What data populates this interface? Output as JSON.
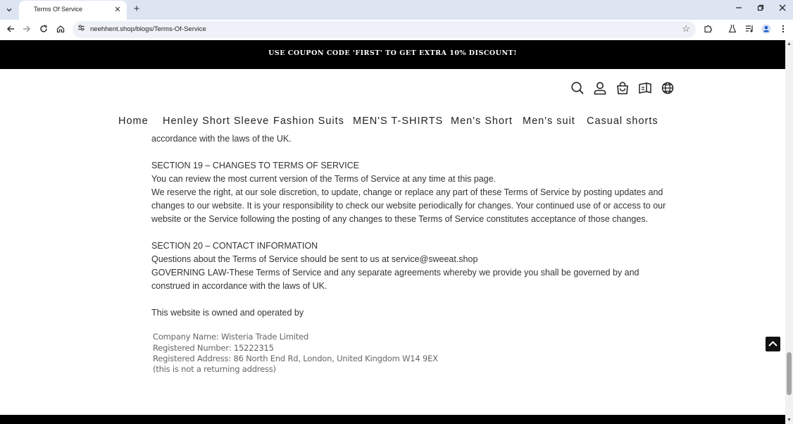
{
  "browser": {
    "tab_title": "Terms Of Service",
    "url": "neehhent.shop/blogs/Terms-Of-Service",
    "icons": [
      "tab-search-icon",
      "close-icon",
      "plus-icon",
      "minimize-icon",
      "restore-icon",
      "close-window-icon",
      "back-icon",
      "forward-icon",
      "reload-icon",
      "home-icon",
      "site-info-icon",
      "bookmark-star-icon",
      "extensions-icon",
      "labs-icon",
      "media-icon",
      "profile-icon",
      "menu-icon"
    ]
  },
  "announcement": "USE COUPON CODE 'FIRST' TO GET EXTRA 10% DISCOUNT!",
  "header_icons": [
    "search-icon",
    "account-icon",
    "cart-icon",
    "catalog-icon",
    "globe-icon"
  ],
  "nav": [
    "Home",
    "Henley Short Sleeve",
    "Fashion Suits",
    "MEN'S T-SHIRTS",
    "Men's Short",
    "Men's suit",
    "Casual shorts"
  ],
  "content": {
    "l1": "accordance with the laws of the UK.",
    "l2": "SECTION 19 – CHANGES TO TERMS OF SERVICE",
    "l3": "You can review the most current version of the Terms of Service at any time at this page.",
    "l4": "We reserve the right, at our sole discretion, to update, change or replace any part of these Terms of Service by posting updates and",
    "l5": "changes to our website. It is your responsibility to check our website periodically for changes. Your continued use of or access to our",
    "l6": "website or the Service following the posting of any changes to these Terms of Service constitutes acceptance of those changes.",
    "l7": "SECTION 20 – CONTACT INFORMATION",
    "l8": "Questions about the Terms of Service should be sent to us at service@sweeat.shop",
    "l9": "GOVERNING LAW-These Terms of Service and any separate  agreements whereby we provide you shall be governed by and",
    "l10": "construed in accordance with the laws of UK.",
    "l11": "This website is owned and operated by"
  },
  "company": {
    "name": "Company Name: Wisteria Trade Limited",
    "number": "Registered Number: 15222315",
    "address": "Registered Address: 86 North End Rd, London, United Kingdom W14 9EX",
    "note": "(this is not a returning address)"
  },
  "colors": {
    "announcement_bg": "#000000",
    "tabstrip_bg": "#dde5f3",
    "text": "#333333"
  }
}
